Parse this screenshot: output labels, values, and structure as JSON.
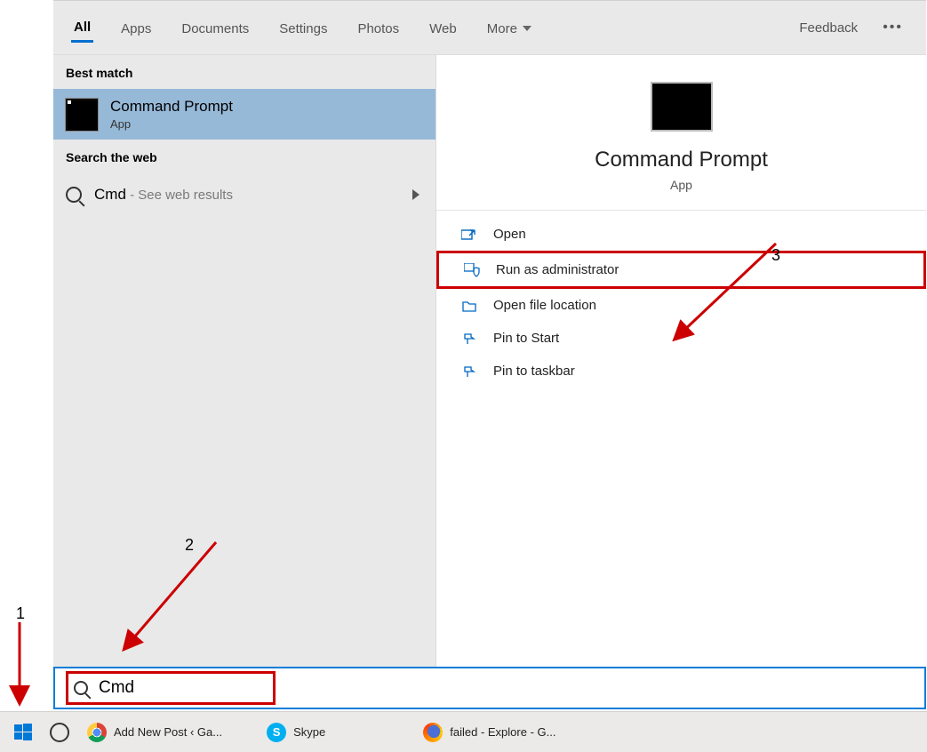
{
  "filters": {
    "all": "All",
    "apps": "Apps",
    "documents": "Documents",
    "settings": "Settings",
    "photos": "Photos",
    "web": "Web",
    "more": "More",
    "feedback": "Feedback"
  },
  "left": {
    "best_match_header": "Best match",
    "match_title": "Command Prompt",
    "match_sub": "App",
    "search_web_header": "Search the web",
    "web_term": "Cmd",
    "web_hint": " - See web results"
  },
  "preview": {
    "title": "Command Prompt",
    "sub": "App",
    "actions": {
      "open": "Open",
      "run_admin": "Run as administrator",
      "open_loc": "Open file location",
      "pin_start": "Pin to Start",
      "pin_taskbar": "Pin to taskbar"
    }
  },
  "search": {
    "value": "Cmd"
  },
  "taskbar": {
    "chrome_title": "Add New Post ‹ Ga...",
    "skype_title": "Skype",
    "firefox_title": "failed - Explore - G..."
  },
  "annotations": {
    "n1": "1",
    "n2": "2",
    "n3": "3"
  }
}
